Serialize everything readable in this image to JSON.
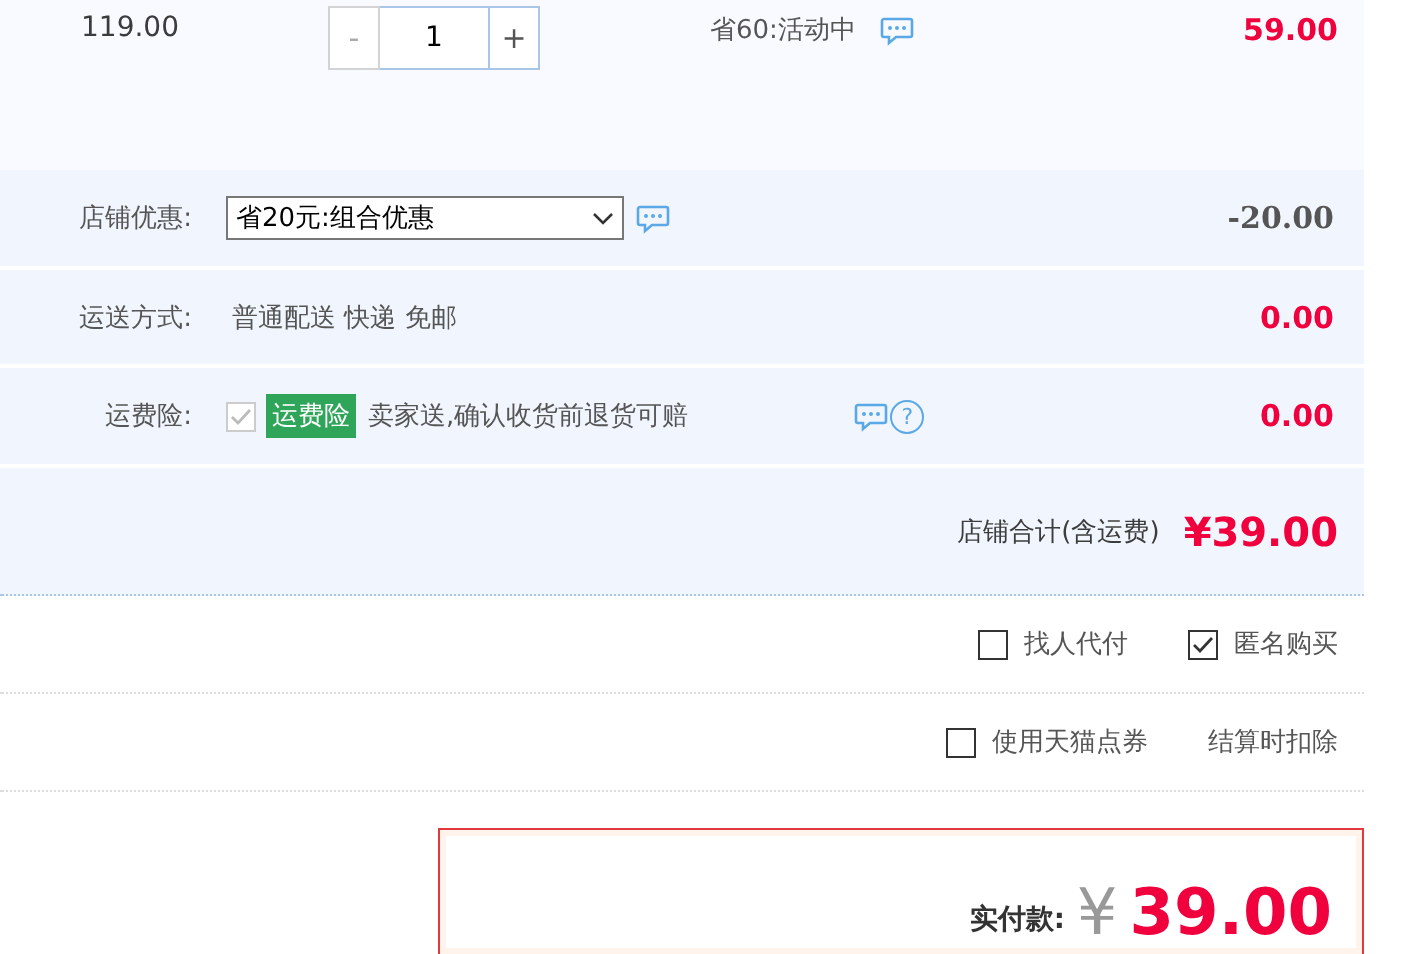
{
  "item": {
    "unit_price": "119.00",
    "quantity": "1",
    "minus": "-",
    "plus": "+",
    "promo": "省60:活动中",
    "subtotal": "59.00"
  },
  "shop_discount": {
    "label": "店铺优惠:",
    "selection": "省20元:组合优惠",
    "amount": "-20.00"
  },
  "shipping": {
    "label": "运送方式:",
    "method": "普通配送 快递 免邮",
    "amount": "0.00"
  },
  "insurance": {
    "label": "运费险:",
    "checked": true,
    "disabled": true,
    "tag": "运费险",
    "description": "卖家送,确认收货前退货可赔",
    "help": "?",
    "amount": "0.00"
  },
  "shop_total": {
    "label": "店铺合计(含运费)",
    "amount": "¥39.00"
  },
  "options": [
    {
      "label": "找人代付",
      "checked": false
    },
    {
      "label": "匿名购买",
      "checked": true
    }
  ],
  "points": {
    "label": "使用天猫点券",
    "checked": false,
    "note": "结算时扣除"
  },
  "payment": {
    "label": "实付款:",
    "currency": "¥",
    "amount": "39.00"
  }
}
